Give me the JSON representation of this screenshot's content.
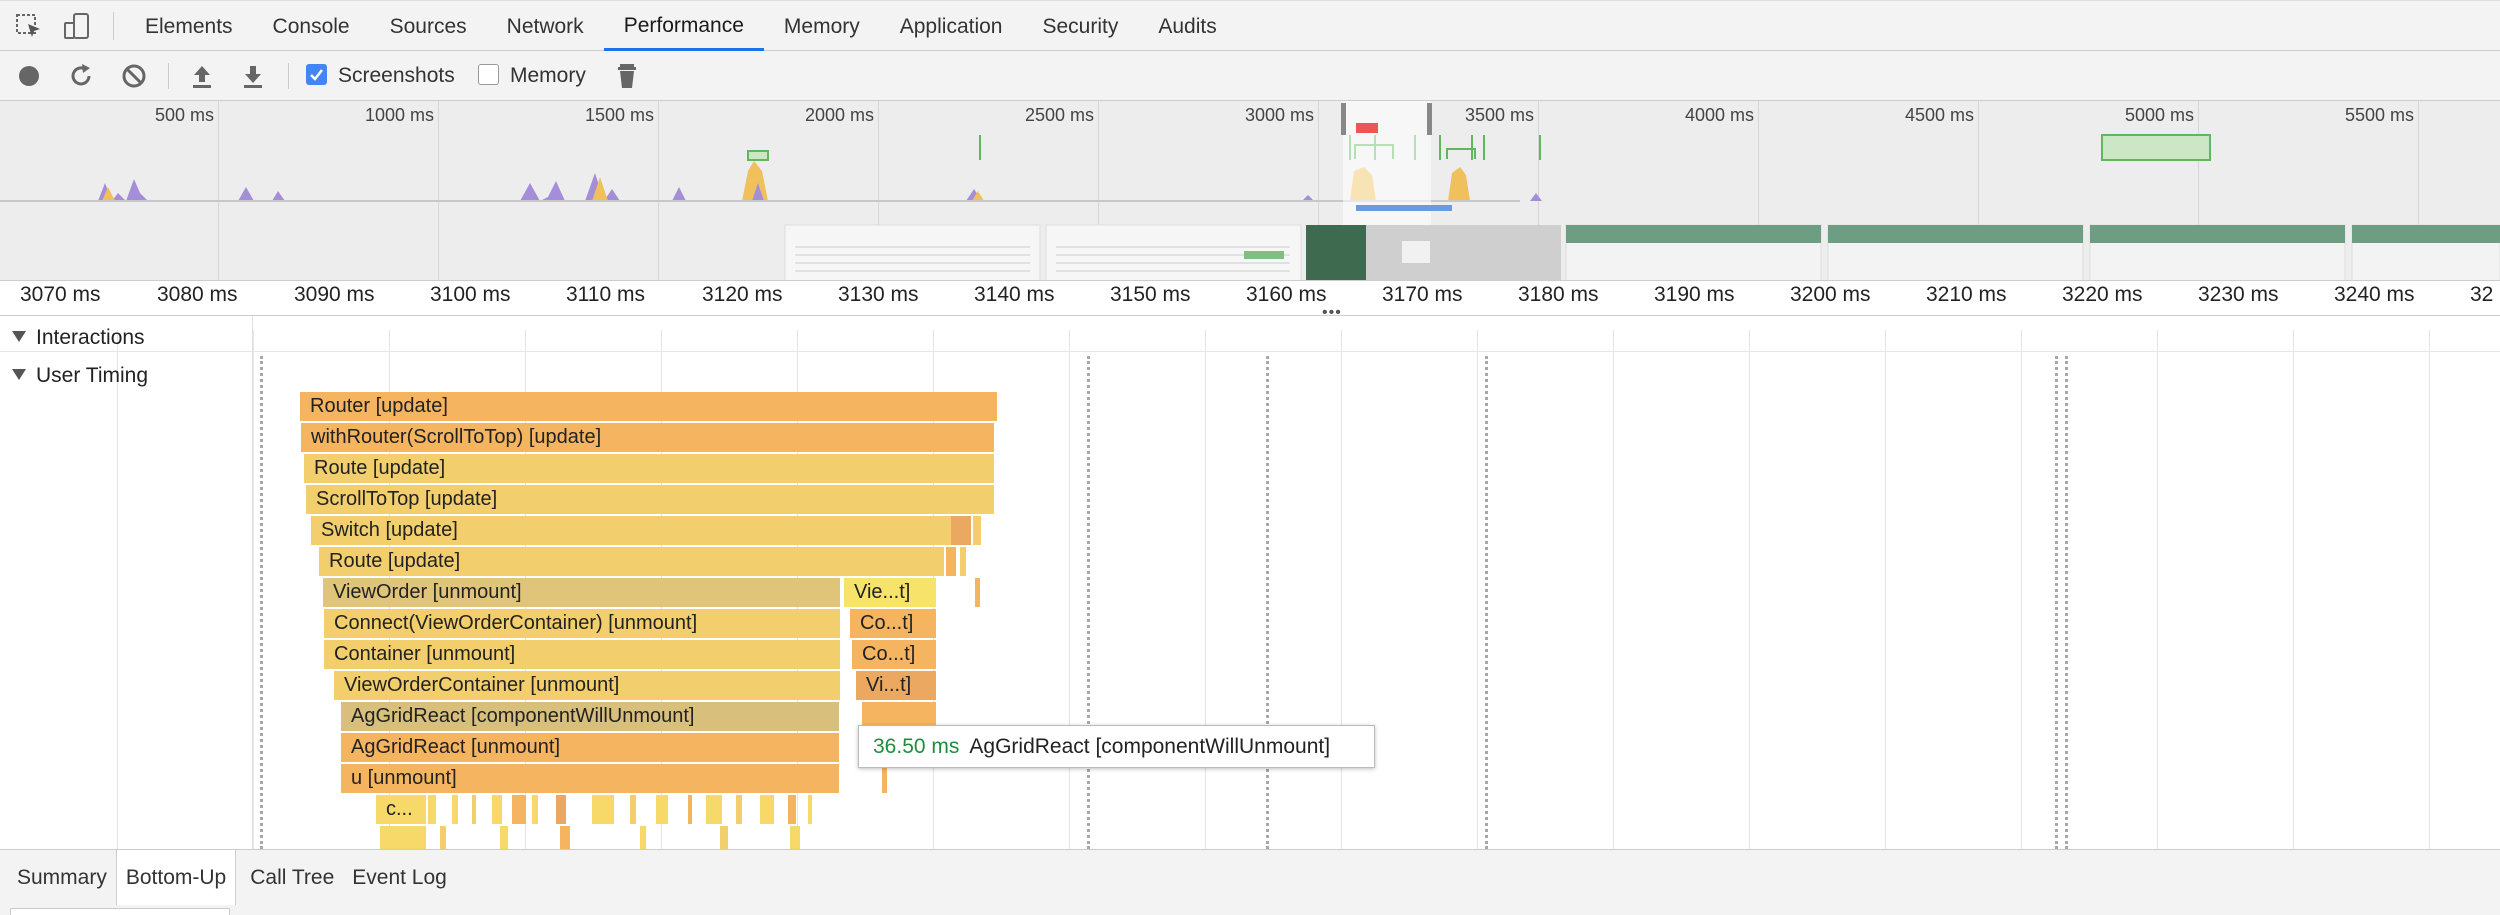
{
  "tabs": [
    "Elements",
    "Console",
    "Sources",
    "Network",
    "Performance",
    "Memory",
    "Application",
    "Security",
    "Audits"
  ],
  "active_tab": "Performance",
  "toolbar": {
    "screenshots_label": "Screenshots",
    "screenshots_checked": true,
    "memory_label": "Memory",
    "memory_checked": false
  },
  "overview_ticks": [
    "500 ms",
    "1000 ms",
    "1500 ms",
    "2000 ms",
    "2500 ms",
    "3000 ms",
    "3500 ms",
    "4000 ms",
    "4500 ms",
    "5000 ms",
    "5500 ms"
  ],
  "ruler_ticks": [
    "3070 ms",
    "3080 ms",
    "3090 ms",
    "3100 ms",
    "3110 ms",
    "3120 ms",
    "3130 ms",
    "3140 ms",
    "3150 ms",
    "3160 ms",
    "3170 ms",
    "3180 ms",
    "3190 ms",
    "3200 ms",
    "3210 ms",
    "3220 ms",
    "3230 ms",
    "3240 ms",
    "32"
  ],
  "tracks": {
    "interactions": "Interactions",
    "user_timing": "User Timing"
  },
  "flame_bars": [
    {
      "label": "Router [update]"
    },
    {
      "label": "withRouter(ScrollToTop) [update]"
    },
    {
      "label": "Route [update]"
    },
    {
      "label": "ScrollToTop [update]"
    },
    {
      "label": "Switch [update]"
    },
    {
      "label": "Route [update]"
    },
    {
      "label": "ViewOrder [unmount]"
    },
    {
      "label": "Connect(ViewOrderContainer) [unmount]"
    },
    {
      "label": "Container [unmount]"
    },
    {
      "label": "ViewOrderContainer [unmount]"
    },
    {
      "label": "AgGridReact [componentWillUnmount]"
    },
    {
      "label": "AgGridReact [unmount]"
    },
    {
      "label": "u [unmount]"
    },
    {
      "label": "c..."
    },
    {
      "label": "Vie...t]"
    },
    {
      "label": "Co...t]"
    },
    {
      "label": "Co...t]"
    },
    {
      "label": "Vi...t]"
    }
  ],
  "tooltip": {
    "duration": "36.50 ms",
    "name": "AgGridReact [componentWillUnmount]"
  },
  "bottom_tabs": [
    "Summary",
    "Bottom-Up",
    "Call Tree",
    "Event Log"
  ],
  "active_bottom_tab": "Bottom-Up",
  "colors": {
    "bar_orange": "#f5b560",
    "bar_yellow": "#f2cf6c",
    "bar_light_yellow": "#f7d96a",
    "bar_khaki": "#d8c07c",
    "tooltip_ms": "#1e8e3e",
    "active_tab_underline": "#1a73e8"
  }
}
